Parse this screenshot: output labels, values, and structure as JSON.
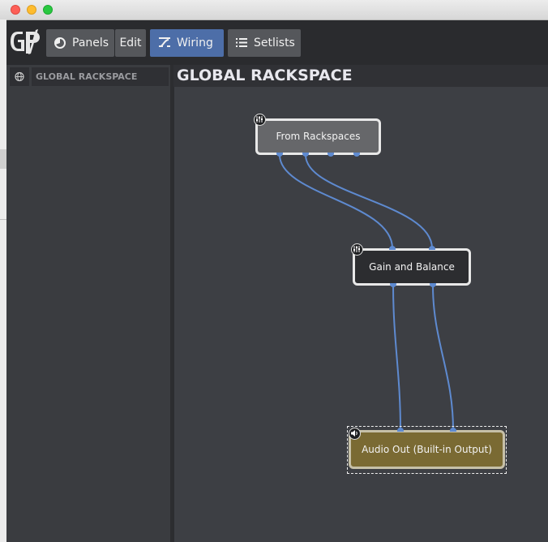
{
  "toolbar": {
    "panels_label": "Panels",
    "edit_label": "Edit",
    "wiring_label": "Wiring",
    "setlists_label": "Setlists",
    "active_tab": "Wiring",
    "accent_color": "#4d6ea8"
  },
  "sidebar": {
    "header_label": "GLOBAL RACKSPACE",
    "header_icon": "globe-icon"
  },
  "main": {
    "title": "GLOBAL RACKSPACE"
  },
  "nodes": {
    "from_rackspaces": {
      "label": "From Rackspaces",
      "icon": "sliders-icon"
    },
    "gain_and_balance": {
      "label": "Gain and Balance",
      "icon": "sliders-icon"
    },
    "audio_out": {
      "label": "Audio Out (Built-in Output)",
      "icon": "speaker-icon",
      "selected": true,
      "color": "#7a6a33"
    }
  },
  "connections": [
    {
      "from": "From Rackspaces",
      "to": "Gain and Balance"
    },
    {
      "from": "From Rackspaces",
      "to": "Gain and Balance"
    },
    {
      "from": "Gain and Balance",
      "to": "Audio Out (Built-in Output)"
    },
    {
      "from": "Gain and Balance",
      "to": "Audio Out (Built-in Output)"
    }
  ],
  "wire_color": "#5e8ad0"
}
